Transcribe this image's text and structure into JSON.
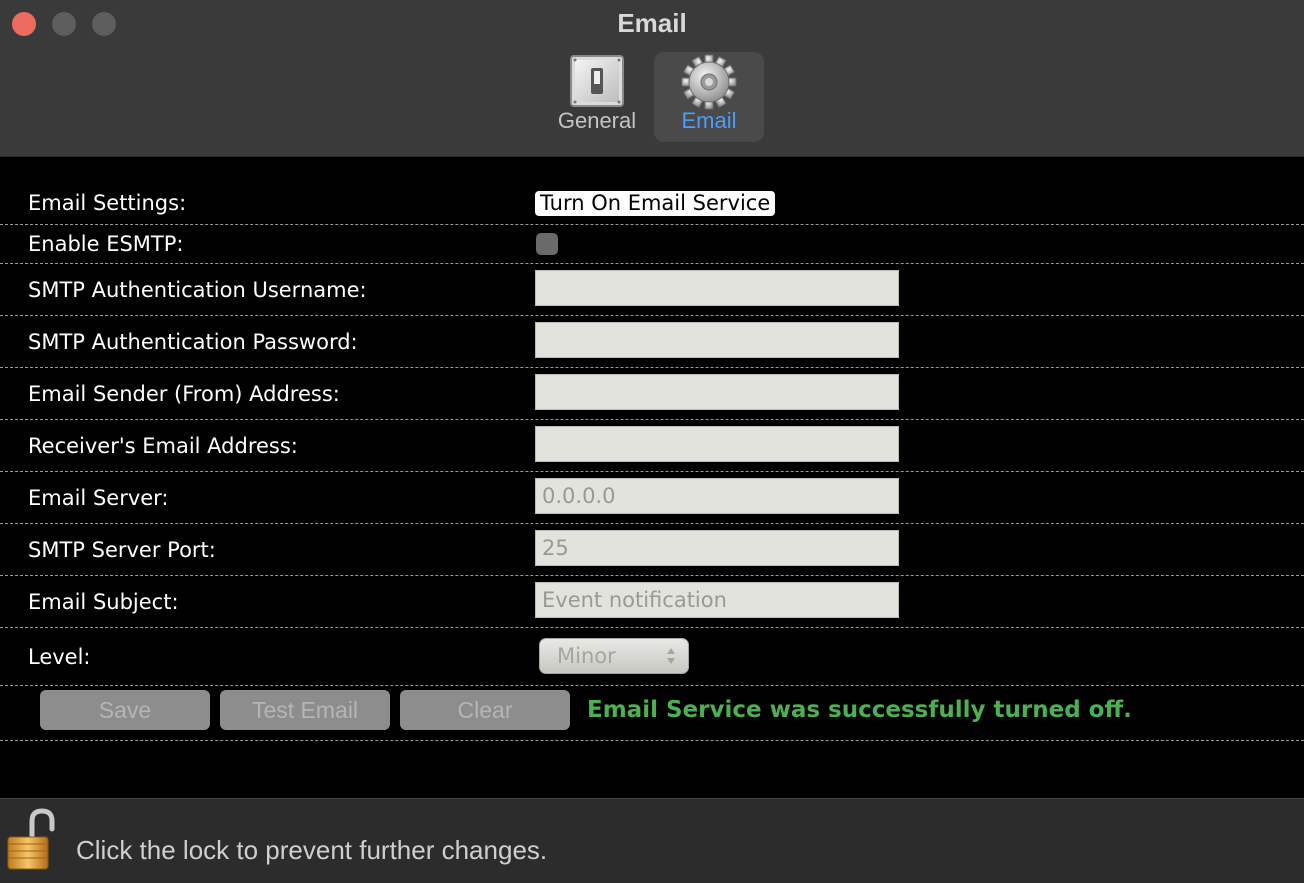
{
  "window": {
    "title": "Email",
    "toolbar": [
      {
        "label": "General",
        "icon": "switch-icon",
        "selected": false
      },
      {
        "label": "Email",
        "icon": "gear-icon",
        "selected": true
      }
    ]
  },
  "form": {
    "email_settings": {
      "label": "Email Settings:",
      "button": "Turn On Email Service"
    },
    "enable_esmtp": {
      "label": "Enable ESMTP:",
      "checked": false
    },
    "smtp_username": {
      "label": "SMTP Authentication Username:",
      "value": ""
    },
    "smtp_password": {
      "label": "SMTP Authentication Password:",
      "value": ""
    },
    "sender_address": {
      "label": "Email Sender (From) Address:",
      "value": ""
    },
    "receiver_address": {
      "label": "Receiver's Email Address:",
      "value": ""
    },
    "email_server": {
      "label": "Email Server:",
      "placeholder": "0.0.0.0"
    },
    "smtp_port": {
      "label": "SMTP Server Port:",
      "placeholder": "25"
    },
    "email_subject": {
      "label": "Email Subject:",
      "placeholder": "Event notification"
    },
    "level": {
      "label": "Level:",
      "selected": "Minor"
    }
  },
  "actions": {
    "save": "Save",
    "test": "Test Email",
    "clear": "Clear",
    "status": "Email Service was successfully turned off.",
    "status_color": "#4caf50"
  },
  "footer": {
    "lock_text": "Click the lock to prevent further changes.",
    "lock_state": "unlocked"
  },
  "colors": {
    "accent": "#4d9cf6",
    "close_button": "#ec6a5e"
  }
}
